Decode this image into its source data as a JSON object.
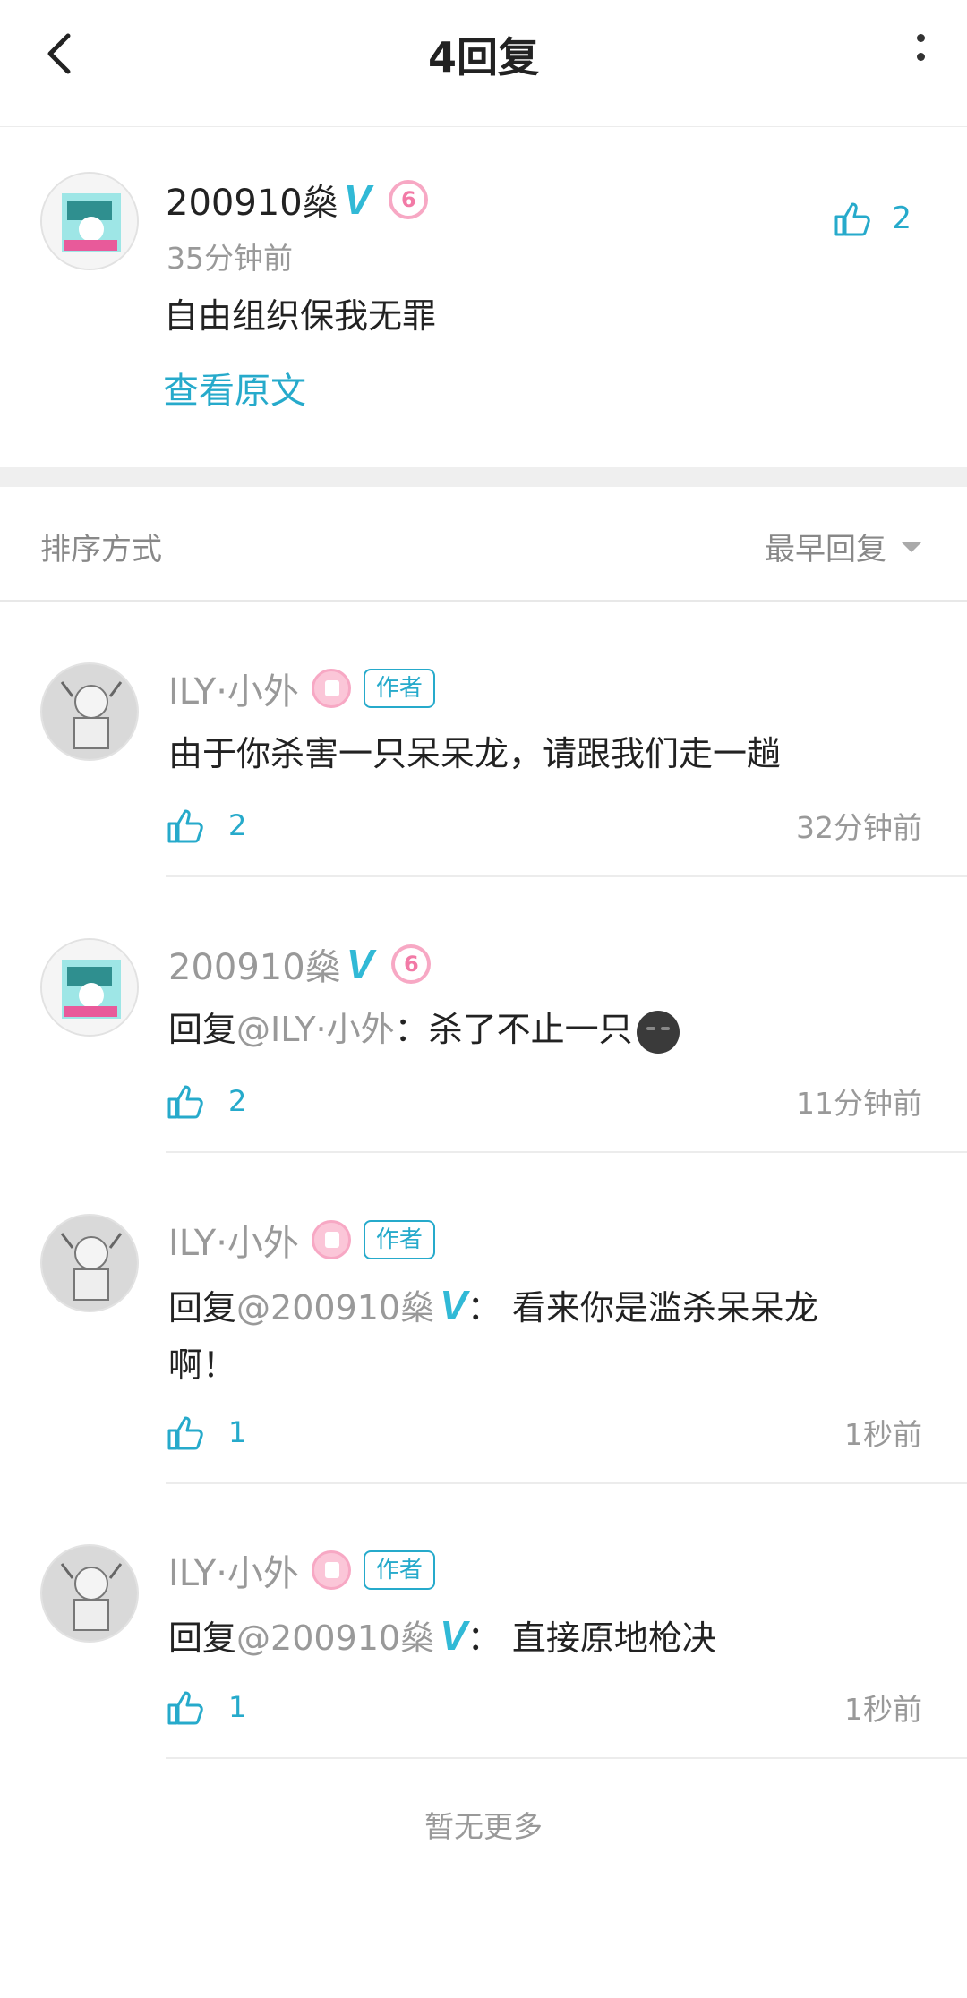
{
  "header": {
    "title": "4回复"
  },
  "original": {
    "username": "200910燊",
    "vip_mark": "V",
    "level_badge": "6",
    "time": "35分钟前",
    "text": "自由组织保我无罪",
    "view_original": "查看原文",
    "likes": "2"
  },
  "sort": {
    "label": "排序方式",
    "value": "最早回复"
  },
  "replies": [
    {
      "username": "ILY·小外",
      "author_tag": "作者",
      "text": "由于你杀害一只呆呆龙，请跟我们走一趟",
      "likes": "2",
      "time": "32分钟前"
    },
    {
      "username": "200910燊",
      "vip_mark": "V",
      "level_badge": "6",
      "reply_prefix": "回复",
      "reply_target": "@ILY·小外",
      "text": "：杀了不止一只",
      "likes": "2",
      "time": "11分钟前"
    },
    {
      "username": "ILY·小外",
      "author_tag": "作者",
      "reply_prefix": "回复",
      "reply_target": "@200910燊",
      "vip_mark": "V",
      "text": "：  看来你是滥杀呆呆龙啊！",
      "likes": "1",
      "time": "1秒前"
    },
    {
      "username": "ILY·小外",
      "author_tag": "作者",
      "reply_prefix": "回复",
      "reply_target": "@200910燊",
      "vip_mark": "V",
      "text": "：  直接原地枪决",
      "likes": "1",
      "time": "1秒前"
    }
  ],
  "footer": {
    "no_more": "暂无更多"
  },
  "colors": {
    "accent": "#26aacb",
    "vip": "#31b9d6",
    "badge_pink": "#f7a8c4"
  }
}
